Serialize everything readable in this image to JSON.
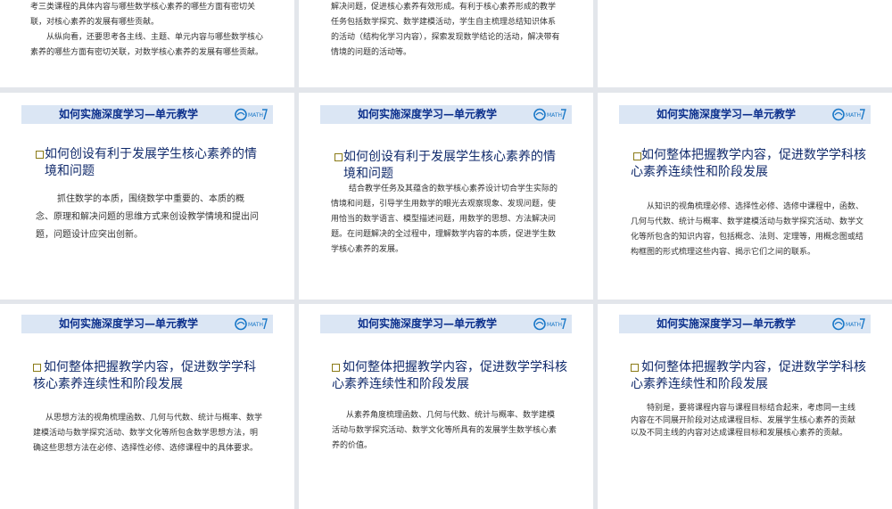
{
  "banner_title": "如何实施深度学习—单元教学",
  "logo_text": "MATH",
  "top": {
    "s1": {
      "p1": "考三类课程的具体内容与哪些数学核心素养的哪些方面有密切关联，对核心素养的发展有哪些贡献。",
      "p2": "从纵向看，还要思考各主线、主题、单元内容与哪些数学核心素养的哪些方面有密切关联，对数学核心素养的发展有哪些贡献。"
    },
    "s2": {
      "p1": "解决问题，促进核心素养有效形成。有利于核心素养形成的教学任务包括数学探究、数学建模活动，学生自主梳理总结知识体系的活动（结构化学习内容），探索发现数学结论的活动，解决带有情境的问题的活动等。"
    }
  },
  "slides": {
    "r2c1": {
      "heading": "如何创设有利于发展学生核心素养的情境和问题",
      "body": "抓住数学的本质，围绕数学中重要的、本质的概念、原理和解决问题的思维方式来创设教学情境和提出问题，问题设计应突出创新。"
    },
    "r2c2": {
      "heading": "如何创设有利于发展学生核心素养的情境和问题",
      "body": "结合教学任务及其蕴含的数学核心素养设计切合学生实际的情境和问题，引导学生用数学的眼光去观察现象、发现问题，使用恰当的数学语言、模型描述问题，用数学的思想、方法解决问题。在问题解决的全过程中，理解数学内容的本质，促进学生数学核心素养的发展。"
    },
    "r2c3": {
      "heading": "如何整体把握教学内容，促进数学学科核心素养连续性和阶段发展",
      "body": "从知识的视角梳理必修、选择性必修、选修中课程中，函数、几何与代数、统计与概率、数学建模活动与数学探究活动、数学文化等所包含的知识内容，包括概念、法则、定理等，用概念图或结构框图的形式梳理这些内容、揭示它们之间的联系。"
    },
    "r3c1": {
      "heading": "如何整体把握教学内容，促进数学学科核心素养连续性和阶段发展",
      "body": "从思想方法的视角梳理函数、几何与代数、统计与概率、数学建模活动与数学探究活动、数学文化等所包含数学思想方法，明确这些思想方法在必修、选择性必修、选修课程中的具体要求。"
    },
    "r3c2": {
      "heading": "如何整体把握教学内容，促进数学学科核心素养连续性和阶段发展",
      "body": "从素养角度梳理函数、几何与代数、统计与概率、数学建模活动与数学探究活动、数学文化等所具有的发展学生数学核心素养的价值。"
    },
    "r3c3": {
      "heading": "如何整体把握教学内容，促进数学学科核心素养连续性和阶段发展",
      "body": "特别是，要将课程内容与课程目标结合起来，考虑同一主线内容在不同展开阶段对达成课程目标、发展学生核心素养的贡献以及不同主线的内容对达成课程目标和发展核心素养的贡献。"
    }
  }
}
